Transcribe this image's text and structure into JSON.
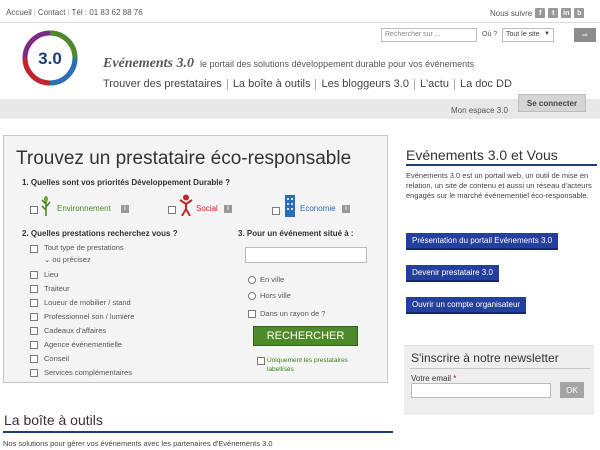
{
  "topbar": {
    "home": "Accueil",
    "contact": "Contact",
    "phone": "Tél : 01 83 62 88 76",
    "follow": "Nous suivre",
    "social": [
      {
        "icon": "facebook-icon",
        "glyph": "f"
      },
      {
        "icon": "twitter-icon",
        "glyph": "t"
      },
      {
        "icon": "linkedin-icon",
        "glyph": "in"
      },
      {
        "icon": "blog-icon",
        "glyph": "b"
      }
    ]
  },
  "header": {
    "logo_text": "3.0",
    "brand": "Evénements 3.0",
    "tagline": "le portail des solutions développement durable pour vos événements"
  },
  "search": {
    "placeholder": "Rechercher sur ...",
    "where_label": "Où ?",
    "scope": "Tout le site",
    "go_glyph": "⇨"
  },
  "nav": [
    "Trouver des prestataires",
    "La boîte à outils",
    "Les bloggeurs 3.0",
    "L'actu",
    "La doc DD"
  ],
  "account": {
    "space": "Mon espace 3.0",
    "connect": "Se connecter"
  },
  "finder": {
    "title": "Trouvez un prestataire éco-responsable",
    "q1": "1. Quelles sont vos priorités Développement Durable ?",
    "priorities": [
      {
        "label": "Environnement",
        "color": "#4f8a2a"
      },
      {
        "label": "Social",
        "color": "#c0262d"
      },
      {
        "label": "Economie",
        "color": "#2a6fb5"
      }
    ],
    "info_glyph": "i",
    "q2": "2. Quelles prestations recherchez vous ?",
    "type_line1": "Tout type de prestations",
    "type_line2": "ou précisez",
    "services": [
      "Lieu",
      "Traiteur",
      "Loueur de mobilier / stand",
      "Professionnel son / lumière",
      "Cadeaux d'affaires",
      "Agence événementielle",
      "Conseil",
      "Services complémentaires"
    ],
    "q3": "3. Pour un événement situé à :",
    "location_options": [
      "En ville",
      "Hors ville"
    ],
    "radius": "Dans un rayon de ?",
    "search_button": "RECHERCHER",
    "labelled_only": "Uniquement les prestataires labellisés"
  },
  "about": {
    "title": "Evénements 3.0 et Vous",
    "text": "Evénements 3.0 est un portail web, un outil de mise en relation, un site de contenu et aussi un réseau d'acteurs engagés sur le marché événementiel éco-responsable.",
    "buttons": [
      "Présentation du portail Evénements 3.0",
      "Devenir prestataire 3.0",
      "Ouvrir un compte organisateur"
    ]
  },
  "newsletter": {
    "title": "S'inscrire à notre newsletter",
    "email_label": "Votre email",
    "required_mark": "*",
    "ok": "OK"
  },
  "toolbox": {
    "title": "La boîte à outils",
    "text": "Nos solutions pour gérer vos événements avec les partenaires d'Evénements 3.0"
  }
}
